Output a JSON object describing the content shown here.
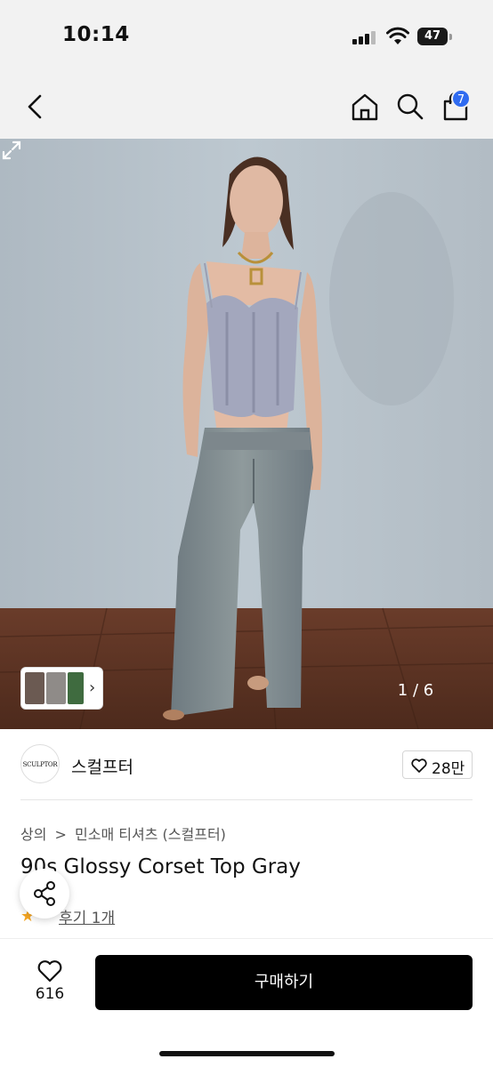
{
  "status_bar": {
    "time": "10:14",
    "battery": "47",
    "icons": [
      "signal-icon",
      "wifi-icon",
      "battery-icon"
    ]
  },
  "nav": {
    "icons": [
      "back-icon",
      "home-icon",
      "search-icon",
      "shopping-bag-icon"
    ],
    "cart_badge": "7",
    "badge_color": "#2f6bf0"
  },
  "gallery": {
    "counter": "1 / 6",
    "thumbnail_arrow": "›",
    "expand_icon": "expand-icon"
  },
  "brand": {
    "logo_text": "SCULPTOR",
    "name": "스컬프터",
    "likes": "28만"
  },
  "product": {
    "breadcrumb": [
      "상의",
      ">",
      "민소매 티셔츠 (스컬프터)"
    ],
    "title": "90s Glossy Corset Top Gray",
    "rating_star": "★",
    "review_link": "후기 1개"
  },
  "bottom_bar": {
    "wishlist_count": "616",
    "buy_label": "구매하기"
  },
  "colors": {
    "primary_button": "#000000",
    "accent_star": "#f5a623"
  }
}
